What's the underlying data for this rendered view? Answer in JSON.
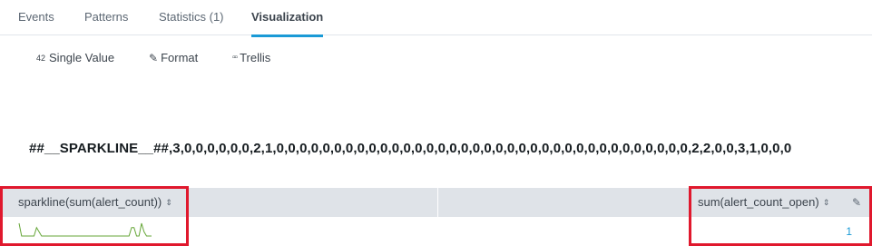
{
  "tabs": [
    {
      "label": "Events"
    },
    {
      "label": "Patterns"
    },
    {
      "label": "Statistics (1)"
    },
    {
      "label": "Visualization"
    }
  ],
  "active_tab": "Visualization",
  "toolbar": {
    "single_value": {
      "icon": "42",
      "label": "Single Value"
    },
    "format": {
      "icon": "pencil-icon",
      "label": "Format"
    },
    "trellis": {
      "icon": "grid-icon",
      "label": "Trellis"
    }
  },
  "single_value_text": "##__SPARKLINE__##,3,0,0,0,0,0,0,2,1,0,0,0,0,0,0,0,0,0,0,0,0,0,0,0,0,0,0,0,0,0,0,0,0,0,0,0,0,0,0,0,0,0,0,0,0,2,2,0,0,3,1,0,0,0",
  "table": {
    "columns": [
      {
        "label": "sparkline(sum(alert_count))",
        "sort_icon": "sort-icon"
      },
      {
        "label": ""
      },
      {
        "label": "sum(alert_count_open)",
        "sort_icon": "sort-icon",
        "extra_icon": "wrench-icon"
      }
    ],
    "rows": [
      {
        "sparkline": [
          3,
          0,
          0,
          0,
          0,
          0,
          0,
          2,
          1,
          0,
          0,
          0,
          0,
          0,
          0,
          0,
          0,
          0,
          0,
          0,
          0,
          0,
          0,
          0,
          0,
          0,
          0,
          0,
          0,
          0,
          0,
          0,
          0,
          0,
          0,
          0,
          0,
          0,
          0,
          0,
          0,
          0,
          0,
          0,
          0,
          2,
          2,
          0,
          0,
          3,
          1,
          0,
          0,
          0
        ],
        "sum_open": "1"
      }
    ]
  },
  "colors": {
    "accent": "#1a9ad6",
    "highlight": "#e0182d",
    "sparkline": "#65a637",
    "header_bg": "#dfe3e8"
  }
}
